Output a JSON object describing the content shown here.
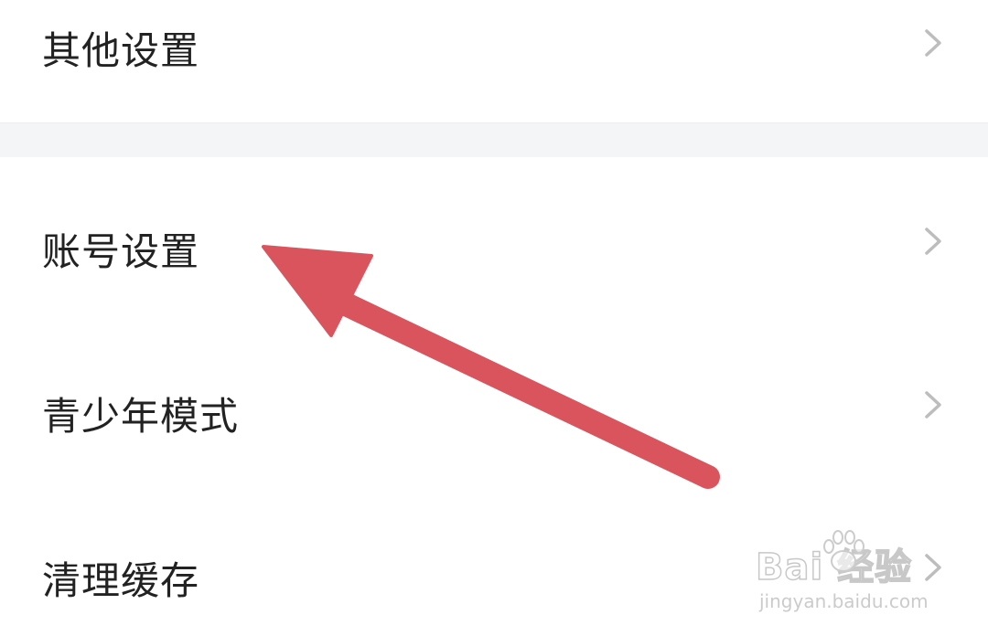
{
  "settings": {
    "items": [
      {
        "label": "其他设置",
        "icon": "chevron-right-icon"
      },
      {
        "label": "账号设置",
        "icon": "chevron-right-icon"
      },
      {
        "label": "青少年模式",
        "icon": "chevron-right-icon"
      },
      {
        "label": "清理缓存",
        "icon": "chevron-right-icon"
      }
    ]
  },
  "annotation": {
    "type": "arrow",
    "points_to": "账号设置",
    "color": "#d9545c"
  },
  "watermark": {
    "brand": "Bai 经验",
    "url": "jingyan.baidu.com"
  },
  "colors": {
    "text": "#222222",
    "chevron": "#bdbdbd",
    "divider_bg": "#f4f5f7"
  }
}
